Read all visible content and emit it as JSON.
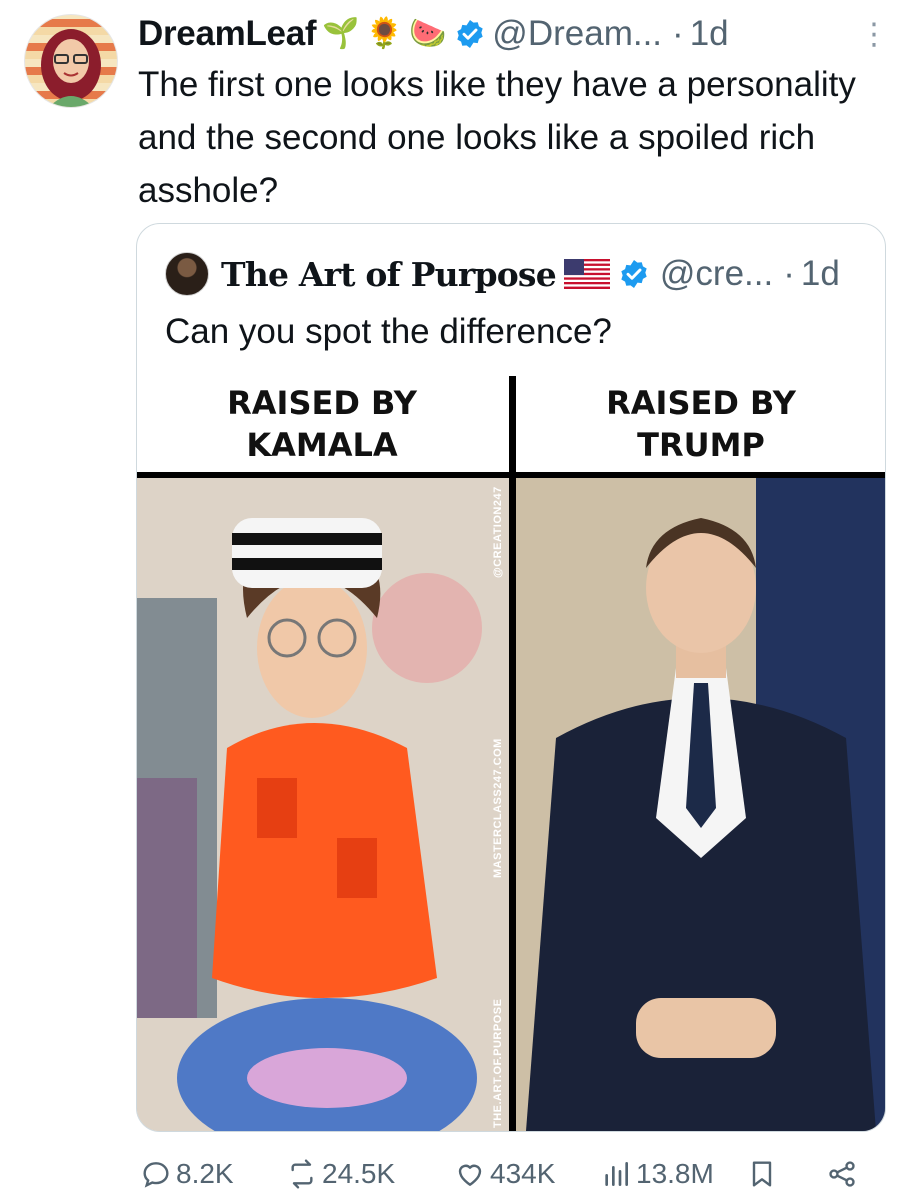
{
  "tweet": {
    "display_name": "DreamLeaf",
    "name_emojis": [
      "🌱",
      "🌻",
      "🍉"
    ],
    "handle": "@Dream...",
    "separator": "·",
    "time": "1d",
    "more": "⋮",
    "text": "The first one looks like they have a personality and the second one looks like a spoiled rich asshole?"
  },
  "quote": {
    "display_name": "The Art of Purpose",
    "handle": "@cre...",
    "separator": "·",
    "time": "1d",
    "text": "Can you spot the difference?",
    "meme": {
      "left_label": [
        "RAISED BY",
        "KAMALA"
      ],
      "right_label": [
        "RAISED BY",
        "TRUMP"
      ],
      "watermarks": [
        "@CREATION247",
        "MASTERCLASS247.COM",
        "THE.ART.OF.PURPOSE"
      ]
    }
  },
  "actions": {
    "replies": "8.2K",
    "retweets": "24.5K",
    "likes": "434K",
    "views": "13.8M"
  },
  "colors": {
    "text_primary": "#0f1419",
    "text_secondary": "#536471",
    "verified_blue": "#1d9bf0",
    "border": "#cfd9de"
  }
}
